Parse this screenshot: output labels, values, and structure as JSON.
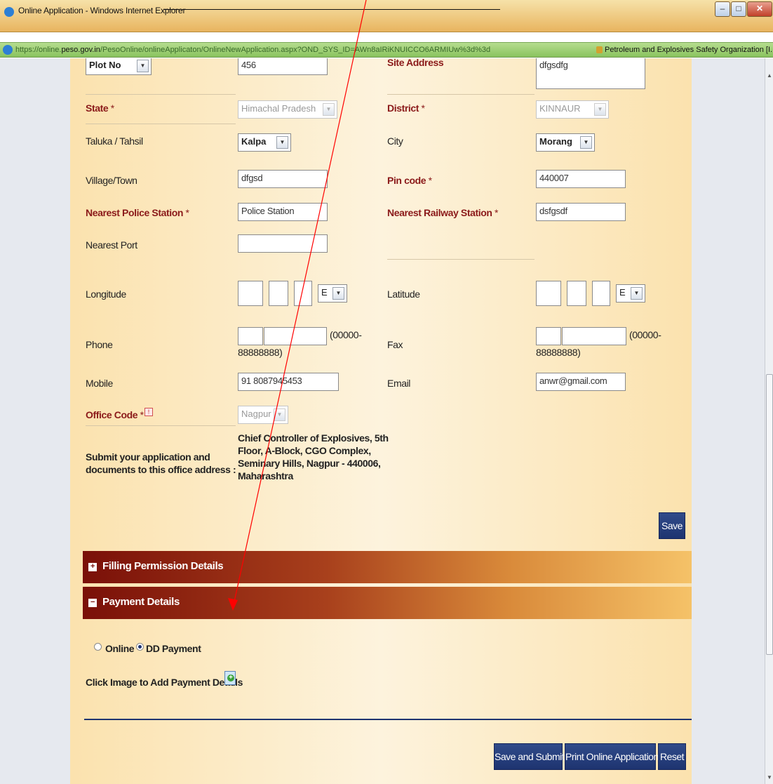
{
  "window": {
    "title": "Online Application - Windows Internet Explorer",
    "url_prefix": "https://online.",
    "url_domain": "peso.gov.in",
    "url_path": "/PesoOnline/onlineApplicaton/OnlineNewApplication.aspx?OND_SYS_ID=AWn8aIRiKNUICCO6ARMIUw%3d%3d",
    "site_name": "Petroleum and Explosives Safety Organization [I..."
  },
  "form": {
    "plot_no_select": "Plot No",
    "plot_no_value": "456",
    "site_address_label": "Site Address",
    "site_address_value": "dfgsdfg",
    "state_label": "State",
    "state_value": "Himachal Pradesh",
    "district_label": "District",
    "district_value": "KINNAUR",
    "taluka_label": "Taluka / Tahsil",
    "taluka_value": "Kalpa",
    "city_label": "City",
    "city_value": "Morang",
    "village_label": "Village/Town",
    "village_value": "dfgsd",
    "pincode_label": "Pin code",
    "pincode_value": "440007",
    "police_label": "Nearest Police Station",
    "police_value": "Police Station",
    "railway_label": "Nearest Railway Station",
    "railway_value": "dsfgsdf",
    "port_label": "Nearest Port",
    "port_value": "",
    "longitude_label": "Longitude",
    "longitude_dir": "E",
    "latitude_label": "Latitude",
    "latitude_dir": "E",
    "phone_label": "Phone",
    "phone_hint_a": "(00000-",
    "phone_hint_b": "88888888)",
    "fax_label": "Fax",
    "fax_hint_a": "(00000-",
    "fax_hint_b": "88888888)",
    "mobile_label": "Mobile",
    "mobile_value": "91 8087945453",
    "email_label": "Email",
    "email_value": "anwr@gmail.com",
    "office_label": "Office Code",
    "office_value": "Nagpur",
    "submit_label_1": "Submit your application and",
    "submit_label_2": "documents to this office address :",
    "office_address_1": "Chief Controller of Explosives, 5th",
    "office_address_2": "Floor, A-Block, CGO Complex,",
    "office_address_3": "Seminary Hills, Nagpur - 440006,",
    "office_address_4": "Maharashtra",
    "required_mark": "*",
    "save_label": "Save"
  },
  "sections": {
    "filling_title": "Filling Permission Details",
    "filling_toggle": "+",
    "payment_title": "Payment Details",
    "payment_toggle": "−"
  },
  "payment": {
    "option_online": "Online",
    "option_dd": "DD Payment",
    "selected": "DD Payment",
    "add_details_label": "Click Image to Add Payment Details"
  },
  "footer": {
    "save_submit": "Save and Submit",
    "print": "Print Online Application",
    "reset": "Reset"
  },
  "colors": {
    "annotation_arrow": "#ff0000",
    "button": "#1e3470",
    "required_label": "#8b1a1a"
  }
}
